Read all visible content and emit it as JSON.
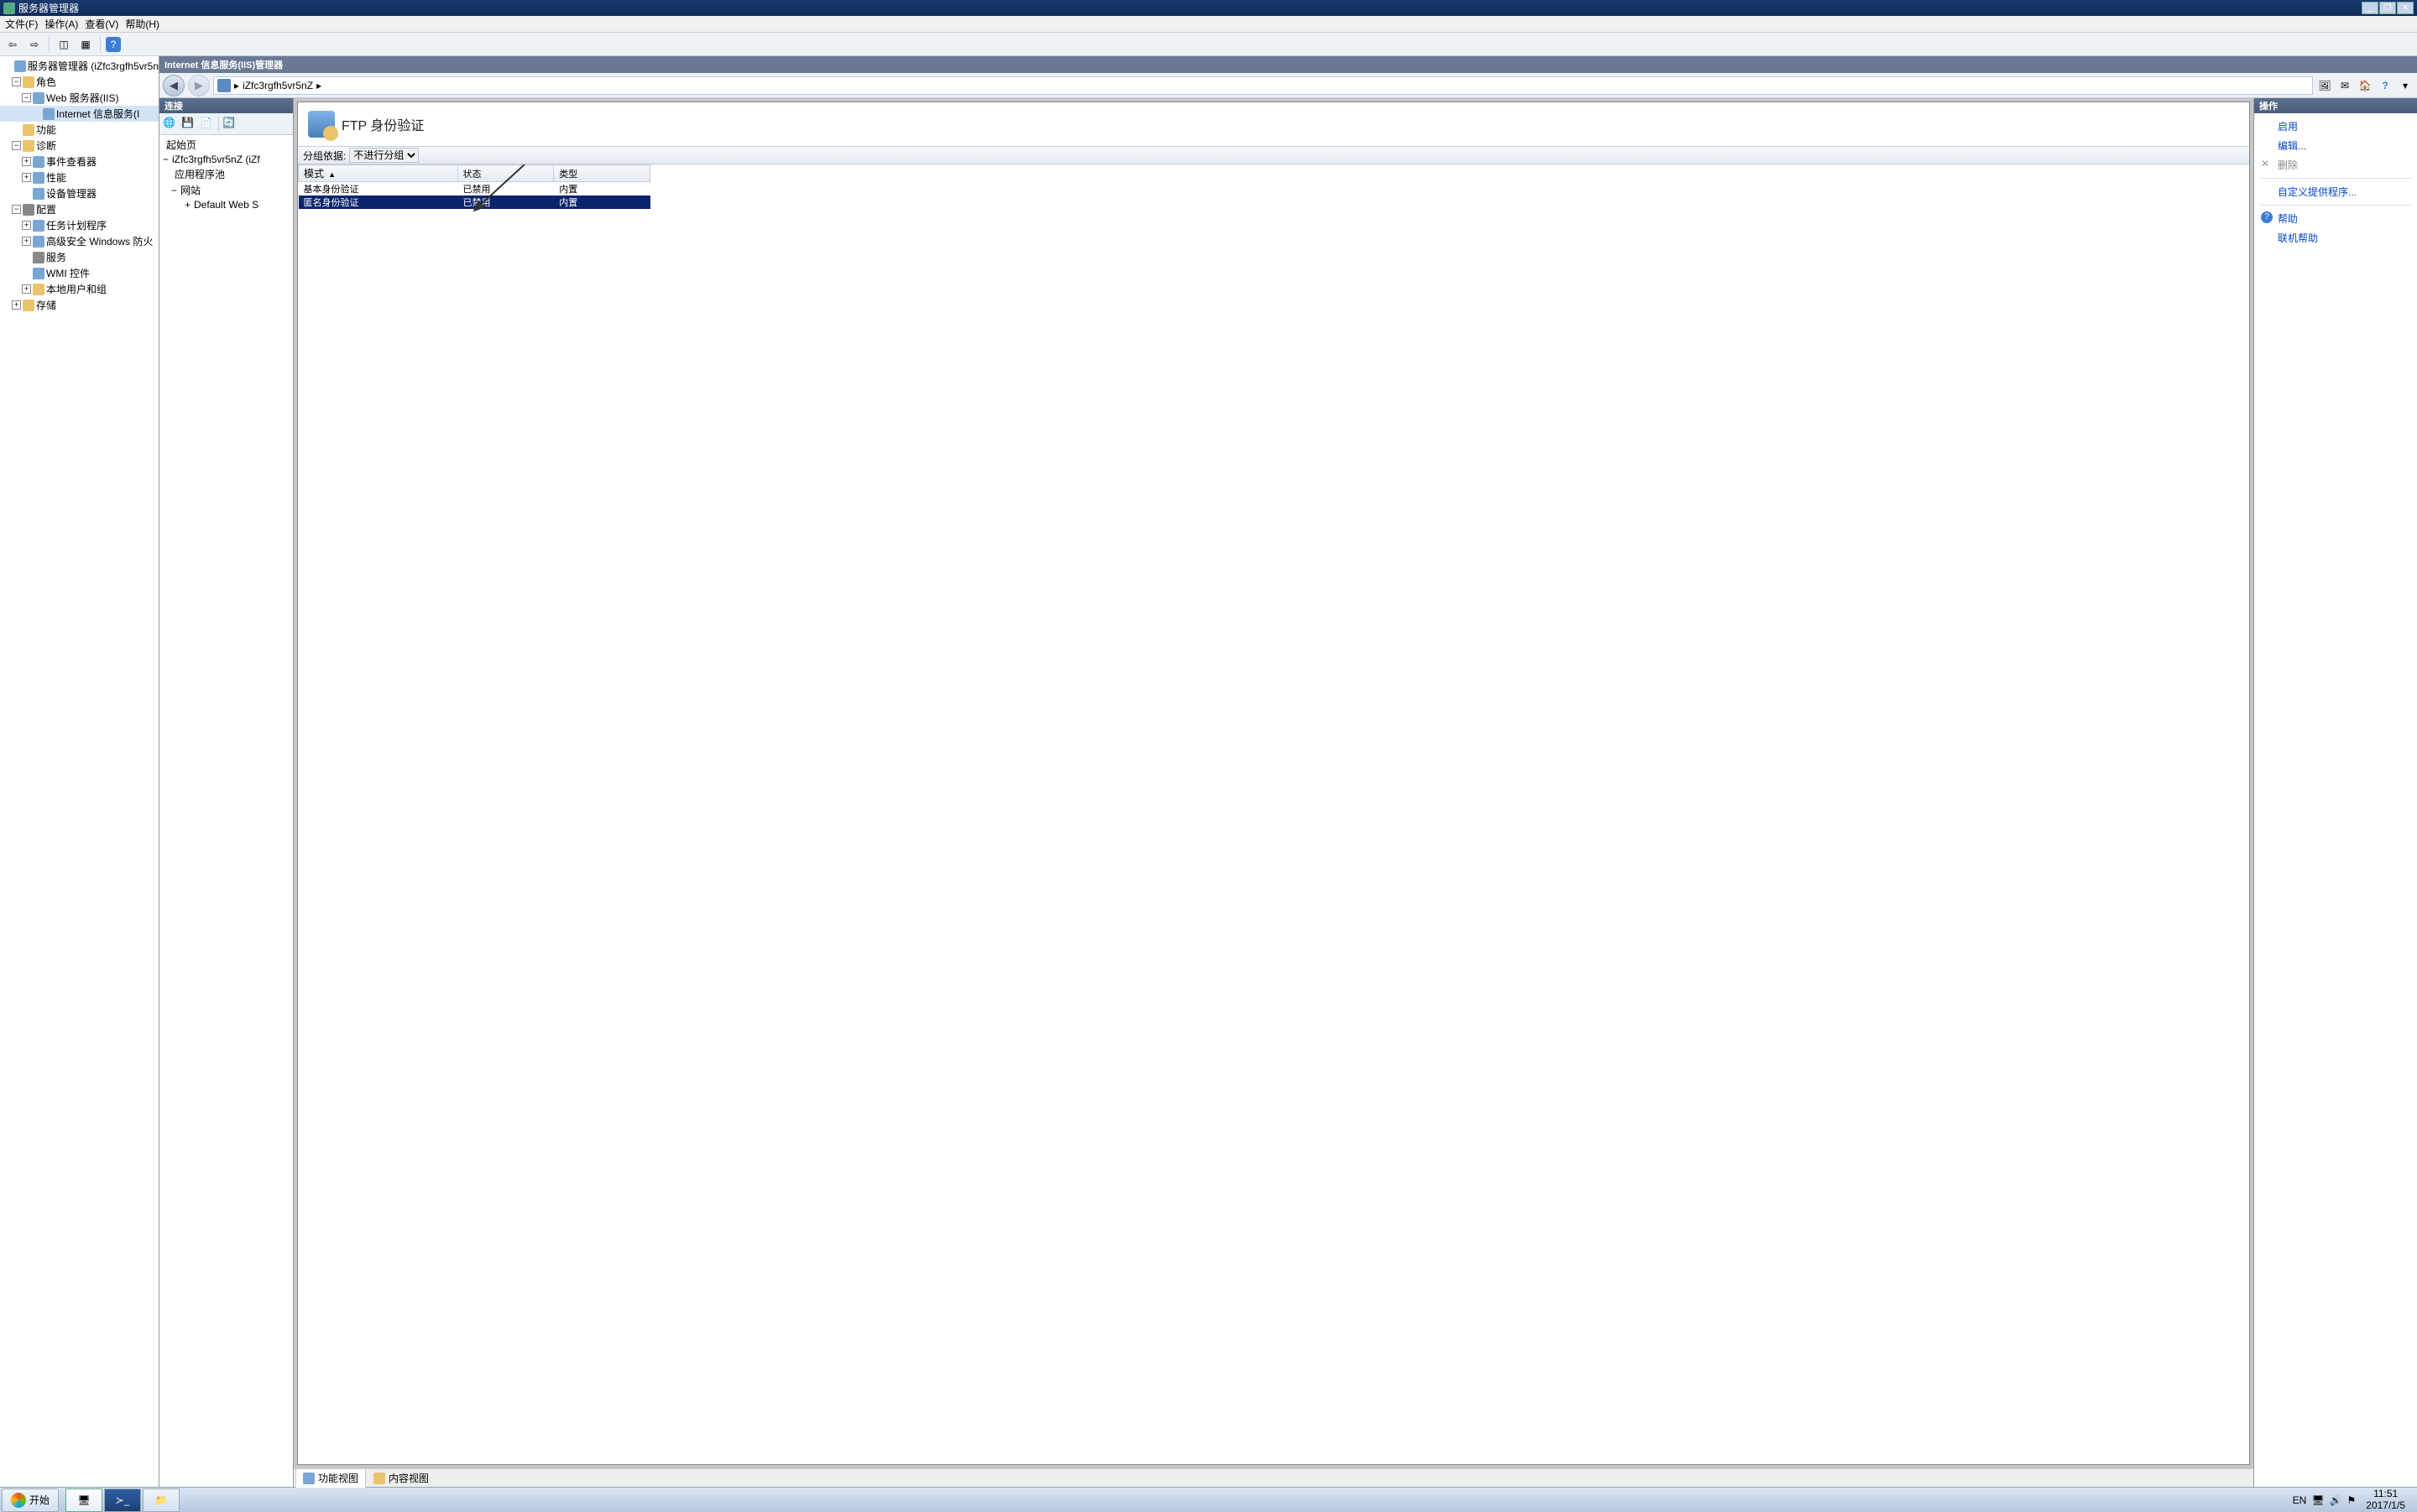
{
  "window": {
    "title": "服务器管理器",
    "min": "_",
    "restore": "❐",
    "close": "✕"
  },
  "menu": {
    "file": "文件(F)",
    "action": "操作(A)",
    "view": "查看(V)",
    "help": "帮助(H)"
  },
  "left_tree": {
    "root": "服务器管理器 (iZfc3rgfh5vr5n",
    "roles": "角色",
    "web_iis": "Web 服务器(IIS)",
    "iis_info": "Internet 信息服务(I",
    "features": "功能",
    "diagnostics": "诊断",
    "event_viewer": "事件查看器",
    "performance": "性能",
    "device_mgr": "设备管理器",
    "config": "配置",
    "task_sched": "任务计划程序",
    "adv_firewall": "高级安全 Windows 防火",
    "services": "服务",
    "wmi": "WMI 控件",
    "local_users": "本地用户和组",
    "storage": "存储"
  },
  "iis": {
    "title_bar": "Internet 信息服务(IIS)管理器",
    "breadcrumb_host": "iZfc3rgfh5vr5nZ",
    "breadcrumb_sep": "▸",
    "connections_hdr": "连接",
    "start_page": "起始页",
    "server_node": "iZfc3rgfh5vr5nZ (iZf",
    "app_pools": "应用程序池",
    "sites": "网站",
    "default_site": "Default Web S"
  },
  "center": {
    "heading": "FTP 身份验证",
    "group_by_label": "分组依据:",
    "group_by_value": "不进行分组",
    "columns": {
      "mode": "模式",
      "status": "状态",
      "type": "类型"
    },
    "sort_indicator": "▲",
    "rows": [
      {
        "mode": "基本身份验证",
        "status": "已禁用",
        "type": "内置",
        "selected": false
      },
      {
        "mode": "匿名身份验证",
        "status": "已禁用",
        "type": "内置",
        "selected": true
      }
    ],
    "view_tabs": {
      "features": "功能视图",
      "content": "内容视图"
    }
  },
  "actions": {
    "hdr": "操作",
    "enable": "启用",
    "edit": "编辑...",
    "delete": "删除",
    "custom_providers": "自定义提供程序...",
    "help": "帮助",
    "online_help": "联机帮助"
  },
  "taskbar": {
    "start": "开始",
    "lang": "EN",
    "time": "11:51",
    "date": "2017/1/5"
  }
}
